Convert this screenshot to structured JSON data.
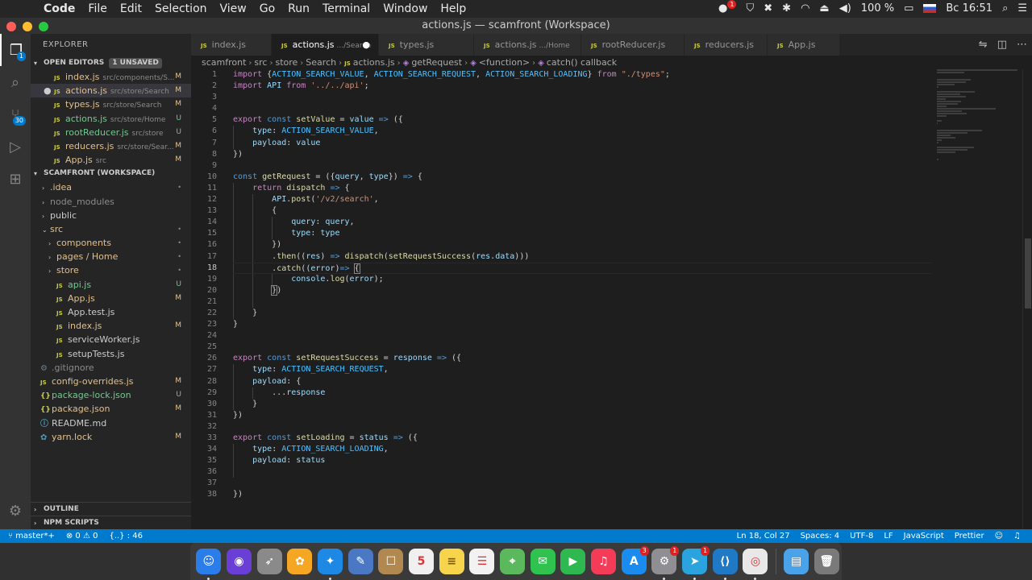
{
  "menubar": {
    "app_name": "Code",
    "items": [
      "File",
      "Edit",
      "Selection",
      "View",
      "Go",
      "Run",
      "Terminal",
      "Window",
      "Help"
    ],
    "battery": "100 %",
    "clock": "Вс 16:51",
    "notif_badge": "1"
  },
  "window": {
    "title": "actions.js — scamfront (Workspace)"
  },
  "activity": {
    "explorer_badge": "1",
    "scm_badge": "30"
  },
  "sidebar": {
    "title": "EXPLORER",
    "open_editors_label": "OPEN EDITORS",
    "unsaved_label": "1 UNSAVED",
    "open_editors": [
      {
        "icon": "JS",
        "name": "index.js",
        "path": "src/components/S...",
        "status": "M",
        "dirty": false
      },
      {
        "icon": "JS",
        "name": "actions.js",
        "path": "src/store/Search",
        "status": "M",
        "dirty": true
      },
      {
        "icon": "JS",
        "name": "types.js",
        "path": "src/store/Search",
        "status": "M",
        "dirty": false
      },
      {
        "icon": "JS",
        "name": "actions.js",
        "path": "src/store/Home",
        "status": "U",
        "dirty": false
      },
      {
        "icon": "JS",
        "name": "rootReducer.js",
        "path": "src/store",
        "status": "U",
        "dirty": false
      },
      {
        "icon": "JS",
        "name": "reducers.js",
        "path": "src/store/Sear...",
        "status": "M",
        "dirty": false
      },
      {
        "icon": "JS",
        "name": "App.js",
        "path": "src",
        "status": "M",
        "dirty": false
      }
    ],
    "workspace_label": "SCAMFRONT (WORKSPACE)",
    "tree": [
      {
        "name": ".idea",
        "kind": "folder",
        "status": "•"
      },
      {
        "name": "node_modules",
        "kind": "folder",
        "status": ""
      },
      {
        "name": "public",
        "kind": "folder",
        "status": ""
      },
      {
        "name": "src",
        "kind": "folder-open",
        "status": "•"
      },
      {
        "name": "components",
        "kind": "subfolder",
        "status": "•"
      },
      {
        "name": "pages / Home",
        "kind": "subfolder",
        "status": "•"
      },
      {
        "name": "store",
        "kind": "subfolder",
        "status": "•"
      },
      {
        "name": "api.js",
        "kind": "js",
        "status": "U"
      },
      {
        "name": "App.js",
        "kind": "js",
        "status": "M"
      },
      {
        "name": "App.test.js",
        "kind": "js",
        "status": ""
      },
      {
        "name": "index.js",
        "kind": "js",
        "status": "M"
      },
      {
        "name": "serviceWorker.js",
        "kind": "js",
        "status": ""
      },
      {
        "name": "setupTests.js",
        "kind": "js",
        "status": ""
      },
      {
        "name": ".gitignore",
        "kind": "gear",
        "status": ""
      },
      {
        "name": "config-overrides.js",
        "kind": "rootjs",
        "status": "M"
      },
      {
        "name": "package-lock.json",
        "kind": "json",
        "status": "U"
      },
      {
        "name": "package.json",
        "kind": "json",
        "status": "M"
      },
      {
        "name": "README.md",
        "kind": "info",
        "status": ""
      },
      {
        "name": "yarn.lock",
        "kind": "yarn",
        "status": "M"
      }
    ],
    "outline_label": "OUTLINE",
    "npm_label": "NPM SCRIPTS"
  },
  "tabs": [
    {
      "name": "index.js",
      "path": "",
      "active": false,
      "dirty": false
    },
    {
      "name": "actions.js",
      "path": ".../Search",
      "active": true,
      "dirty": true
    },
    {
      "name": "types.js",
      "path": "",
      "active": false,
      "dirty": false
    },
    {
      "name": "actions.js",
      "path": ".../Home",
      "active": false,
      "dirty": false
    },
    {
      "name": "rootReducer.js",
      "path": "",
      "active": false,
      "dirty": false
    },
    {
      "name": "reducers.js",
      "path": "",
      "active": false,
      "dirty": false
    },
    {
      "name": "App.js",
      "path": "",
      "active": false,
      "dirty": false
    }
  ],
  "breadcrumb": [
    "scamfront",
    "src",
    "store",
    "Search",
    "actions.js",
    "getRequest",
    "<function>",
    "catch() callback"
  ],
  "editor": {
    "current_line": 18,
    "lines": [
      [
        [
          "kw2",
          "import"
        ],
        [
          "pun",
          " {"
        ],
        [
          "cst",
          "ACTION_SEARCH_VALUE"
        ],
        [
          "pun",
          ", "
        ],
        [
          "cst",
          "ACTION_SEARCH_REQUEST"
        ],
        [
          "pun",
          ", "
        ],
        [
          "cst",
          "ACTION_SEARCH_LOADING"
        ],
        [
          "pun",
          "} "
        ],
        [
          "kw2",
          "from"
        ],
        [
          "pun",
          " "
        ],
        [
          "str",
          "\"./types\""
        ],
        [
          "pun",
          ";"
        ]
      ],
      [
        [
          "kw2",
          "import"
        ],
        [
          "pun",
          " "
        ],
        [
          "var",
          "API"
        ],
        [
          "pun",
          " "
        ],
        [
          "kw2",
          "from"
        ],
        [
          "pun",
          " "
        ],
        [
          "str",
          "'../../api'"
        ],
        [
          "pun",
          ";"
        ]
      ],
      [],
      [],
      [
        [
          "kw2",
          "export"
        ],
        [
          "pun",
          " "
        ],
        [
          "kw",
          "const"
        ],
        [
          "pun",
          " "
        ],
        [
          "fn",
          "setValue"
        ],
        [
          "pun",
          " = "
        ],
        [
          "var",
          "value"
        ],
        [
          "pun",
          " "
        ],
        [
          "kw",
          "=>"
        ],
        [
          "pun",
          " ({"
        ]
      ],
      [
        [
          "pun",
          "    "
        ],
        [
          "var",
          "type"
        ],
        [
          "pun",
          ": "
        ],
        [
          "cst",
          "ACTION_SEARCH_VALUE"
        ],
        [
          "pun",
          ","
        ]
      ],
      [
        [
          "pun",
          "    "
        ],
        [
          "var",
          "payload"
        ],
        [
          "pun",
          ": "
        ],
        [
          "var",
          "value"
        ]
      ],
      [
        [
          "pun",
          "})"
        ]
      ],
      [],
      [
        [
          "kw",
          "const"
        ],
        [
          "pun",
          " "
        ],
        [
          "fn",
          "getRequest"
        ],
        [
          "pun",
          " = ({"
        ],
        [
          "var",
          "query"
        ],
        [
          "pun",
          ", "
        ],
        [
          "var",
          "type"
        ],
        [
          "pun",
          "}) "
        ],
        [
          "kw",
          "=>"
        ],
        [
          "pun",
          " {"
        ]
      ],
      [
        [
          "pun",
          "    "
        ],
        [
          "kw2",
          "return"
        ],
        [
          "pun",
          " "
        ],
        [
          "fn",
          "dispatch"
        ],
        [
          "pun",
          " "
        ],
        [
          "kw",
          "=>"
        ],
        [
          "pun",
          " {"
        ]
      ],
      [
        [
          "pun",
          "        "
        ],
        [
          "var",
          "API"
        ],
        [
          "pun",
          "."
        ],
        [
          "fn",
          "post"
        ],
        [
          "pun",
          "("
        ],
        [
          "str",
          "'/v2/search'"
        ],
        [
          "pun",
          ","
        ]
      ],
      [
        [
          "pun",
          "        {"
        ]
      ],
      [
        [
          "pun",
          "            "
        ],
        [
          "var",
          "query"
        ],
        [
          "pun",
          ": "
        ],
        [
          "var",
          "query"
        ],
        [
          "pun",
          ","
        ]
      ],
      [
        [
          "pun",
          "            "
        ],
        [
          "var",
          "type"
        ],
        [
          "pun",
          ": "
        ],
        [
          "var",
          "type"
        ]
      ],
      [
        [
          "pun",
          "        })"
        ]
      ],
      [
        [
          "pun",
          "        ."
        ],
        [
          "fn",
          "then"
        ],
        [
          "pun",
          "(("
        ],
        [
          "var",
          "res"
        ],
        [
          "pun",
          ") "
        ],
        [
          "kw",
          "=>"
        ],
        [
          "pun",
          " "
        ],
        [
          "fn",
          "dispatch"
        ],
        [
          "pun",
          "("
        ],
        [
          "fn",
          "setRequestSuccess"
        ],
        [
          "pun",
          "("
        ],
        [
          "var",
          "res"
        ],
        [
          "pun",
          "."
        ],
        [
          "var",
          "data"
        ],
        [
          "pun",
          ")))"
        ]
      ],
      [
        [
          "pun",
          "        ."
        ],
        [
          "fn",
          "catch"
        ],
        [
          "pun",
          "(("
        ],
        [
          "var",
          "error"
        ],
        [
          "pun",
          ")"
        ],
        [
          "kw",
          "=>"
        ],
        [
          "pun",
          " "
        ],
        [
          "bracket",
          "{"
        ]
      ],
      [
        [
          "pun",
          "            "
        ],
        [
          "var",
          "console"
        ],
        [
          "pun",
          "."
        ],
        [
          "fn",
          "log"
        ],
        [
          "pun",
          "("
        ],
        [
          "var",
          "error"
        ],
        [
          "pun",
          ");"
        ]
      ],
      [
        [
          "pun",
          "        "
        ],
        [
          "bracket",
          "}"
        ],
        [
          "pun",
          ")"
        ]
      ],
      [],
      [
        [
          "pun",
          "    }"
        ]
      ],
      [
        [
          "pun",
          "}"
        ]
      ],
      [],
      [],
      [
        [
          "kw2",
          "export"
        ],
        [
          "pun",
          " "
        ],
        [
          "kw",
          "const"
        ],
        [
          "pun",
          " "
        ],
        [
          "fn",
          "setRequestSuccess"
        ],
        [
          "pun",
          " = "
        ],
        [
          "var",
          "response"
        ],
        [
          "pun",
          " "
        ],
        [
          "kw",
          "=>"
        ],
        [
          "pun",
          " ({"
        ]
      ],
      [
        [
          "pun",
          "    "
        ],
        [
          "var",
          "type"
        ],
        [
          "pun",
          ": "
        ],
        [
          "cst",
          "ACTION_SEARCH_REQUEST"
        ],
        [
          "pun",
          ","
        ]
      ],
      [
        [
          "pun",
          "    "
        ],
        [
          "var",
          "payload"
        ],
        [
          "pun",
          ": {"
        ]
      ],
      [
        [
          "pun",
          "        ..."
        ],
        [
          "var",
          "response"
        ]
      ],
      [
        [
          "pun",
          "    }"
        ]
      ],
      [
        [
          "pun",
          "})"
        ]
      ],
      [],
      [
        [
          "kw2",
          "export"
        ],
        [
          "pun",
          " "
        ],
        [
          "kw",
          "const"
        ],
        [
          "pun",
          " "
        ],
        [
          "fn",
          "setLoading"
        ],
        [
          "pun",
          " = "
        ],
        [
          "var",
          "status"
        ],
        [
          "pun",
          " "
        ],
        [
          "kw",
          "=>"
        ],
        [
          "pun",
          " ({"
        ]
      ],
      [
        [
          "pun",
          "    "
        ],
        [
          "var",
          "type"
        ],
        [
          "pun",
          ": "
        ],
        [
          "cst",
          "ACTION_SEARCH_LOADING"
        ],
        [
          "pun",
          ","
        ]
      ],
      [
        [
          "pun",
          "    "
        ],
        [
          "var",
          "payload"
        ],
        [
          "pun",
          ": "
        ],
        [
          "var",
          "status"
        ]
      ],
      [],
      [],
      [
        [
          "pun",
          "})"
        ]
      ]
    ]
  },
  "statusbar": {
    "branch": "master*+",
    "problems": "⊗ 0 ⚠ 0",
    "scope": "{..} : 46",
    "position": "Ln 18, Col 27",
    "spaces": "Spaces: 4",
    "encoding": "UTF-8",
    "eol": "LF",
    "language": "JavaScript",
    "formatter": "Prettier"
  },
  "dock": {
    "apps": [
      {
        "name": "finder",
        "glyph": "☺",
        "color": "#2b7de9",
        "badge": "",
        "running": true
      },
      {
        "name": "siri",
        "glyph": "◉",
        "color": "#6a3fd6",
        "badge": "",
        "running": false
      },
      {
        "name": "launchpad",
        "glyph": "➶",
        "color": "#8a8a8a",
        "badge": "",
        "running": false
      },
      {
        "name": "photos",
        "glyph": "✿",
        "color": "#f5a623",
        "badge": "",
        "running": false
      },
      {
        "name": "safari",
        "glyph": "✦",
        "color": "#1e88e5",
        "badge": "",
        "running": true
      },
      {
        "name": "preview",
        "glyph": "✎",
        "color": "#4a78c2",
        "badge": "",
        "running": false
      },
      {
        "name": "contacts",
        "glyph": "☐",
        "color": "#b08850",
        "badge": "",
        "running": false
      },
      {
        "name": "calendar",
        "glyph": "5",
        "color": "#f0f0f0",
        "badge": "",
        "running": false
      },
      {
        "name": "notes",
        "glyph": "≡",
        "color": "#f7d44c",
        "badge": "",
        "running": false
      },
      {
        "name": "reminders",
        "glyph": "☰",
        "color": "#f2f2f2",
        "badge": "",
        "running": false
      },
      {
        "name": "maps",
        "glyph": "⌖",
        "color": "#5cb85c",
        "badge": "",
        "running": false
      },
      {
        "name": "messages",
        "glyph": "✉",
        "color": "#30c24f",
        "badge": "",
        "running": false
      },
      {
        "name": "facetime",
        "glyph": "▶",
        "color": "#2fb84f",
        "badge": "",
        "running": false
      },
      {
        "name": "music",
        "glyph": "♫",
        "color": "#f43b58",
        "badge": "",
        "running": false
      },
      {
        "name": "app-store",
        "glyph": "A",
        "color": "#1a8cf0",
        "badge": "3",
        "running": false
      },
      {
        "name": "system-preferences",
        "glyph": "⚙",
        "color": "#8e8e93",
        "badge": "1",
        "running": true
      },
      {
        "name": "telegram",
        "glyph": "➤",
        "color": "#2aa3de",
        "badge": "1",
        "running": true
      },
      {
        "name": "vs-code",
        "glyph": "⟨⟩",
        "color": "#1f79c4",
        "badge": "",
        "running": true
      },
      {
        "name": "chrome",
        "glyph": "◎",
        "color": "#e8e8e8",
        "badge": "",
        "running": true
      }
    ],
    "trailing": [
      {
        "name": "downloads-folder",
        "glyph": "▤",
        "color": "#4aa3e8"
      },
      {
        "name": "trash",
        "glyph": "🗑",
        "color": "#7a7a7a"
      }
    ]
  }
}
